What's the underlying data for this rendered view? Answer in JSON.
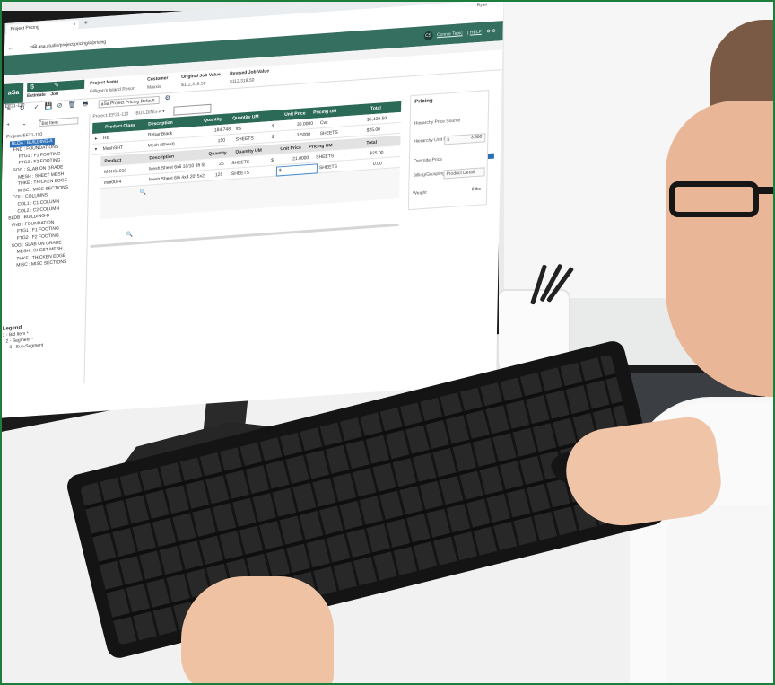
{
  "browser": {
    "tab_title": "Project Pricing",
    "tab_close": "×",
    "new_tab": "+",
    "window_controls": "–  □  ×",
    "user_chip": "Ryan",
    "nav_buttons": "←  →  C",
    "url": "trial.asa.studio/project/pricing/#/pricing"
  },
  "app_header": {
    "avatar_initials": "CS",
    "company_link": "Connie Tepic",
    "separator": "|",
    "help": "HELP",
    "icons": "⚙  ⚙"
  },
  "job_bar": {
    "logo": "aSa",
    "icons": "$  ✎  ▤  ▮",
    "side_labels": [
      "Estimate",
      "Job"
    ],
    "job_number": "EF21-110",
    "columns": [
      {
        "header": "Project Name",
        "value": "Gilligan's Island Resort"
      },
      {
        "header": "Customer",
        "value": "Maxxis"
      },
      {
        "header": "Original Job Value",
        "value": "$112,318.50"
      },
      {
        "header": "Revised Job Value",
        "value": "$112,318.50"
      }
    ]
  },
  "toolbar": {
    "icons": [
      "≡",
      "↻",
      "✓",
      "💾",
      "⊘",
      "🗑",
      "🖶"
    ],
    "pricing_select": "aSa Project Pricing Default",
    "gear": "⚙"
  },
  "breadcrumb": {
    "project": "Project: EF21-110",
    "building": "BUILDING-A ▾"
  },
  "sidebar": {
    "tools": "+  ⌄  ^",
    "filter": "Bid Item",
    "tree": [
      "Project: EF21-110",
      "BLDA : BUILDING-A",
      "FND : FOUNDATIONS",
      "FTG1 : F1 FOOTING",
      "FTG2 : F2 FOOTING",
      "SOG : SLAB ON GRADE",
      "MESH : SHEET MESH",
      "THKE : THICKEN EDGE",
      "MISC : MISC SECTIONS",
      "COL : COLUMNS",
      "COL1 : C1 COLUMN",
      "COL2 : C2 COLUMN",
      "BLDB : BUILDING-B",
      "FND : FOUNDATION",
      "FTG1 : F1 FOOTING",
      "FTG2 : F2 FOOTING",
      "SOG : SLAB ON GRADE",
      "MESH : SHEET MESH",
      "THKE : THICKEN EDGE",
      "MISC : MISC SECTIONS"
    ],
    "legend_title": "Legend",
    "legend_items": [
      "1 - Bid Item *",
      "2 - Segment *",
      "3 - Sub-Segment"
    ]
  },
  "grid": {
    "headers": [
      "Product Class",
      "Description",
      "Quantity",
      "Quantity UM",
      "Unit Price",
      "Pricing UM",
      "Total"
    ],
    "rows": [
      {
        "expand": "▸",
        "class": "RB",
        "description": "Rebar Black",
        "quantity": "184,748",
        "qty_um": "lbs",
        "unit_price": "$",
        "price": "30.0000",
        "pricing_um": "Cwt",
        "total": "$5,429.50"
      },
      {
        "expand": "▾",
        "class": "MeshSHT",
        "description": "Mesh (Sheet)",
        "quantity": "150",
        "qty_um": "SHEETS",
        "unit_price": "$",
        "price": "3.5000",
        "pricing_um": "SHEETS",
        "total": "$25.00"
      }
    ],
    "sub_headers": [
      "Product",
      "Description",
      "Quantity",
      "Quantity UM",
      "Unit Price",
      "Pricing UM",
      "Total"
    ],
    "sub_rows": [
      {
        "product": "MSH61010",
        "description": "Mesh Sheet 6x6 10/10 8ft 5f",
        "quantity": "25",
        "qty_um": "SHEETS",
        "unit_price": "$",
        "price": "21.0000",
        "pricing_um": "SHEETS",
        "total": "$25.00"
      },
      {
        "product": "mm0044",
        "description": "Mesh Sheet 6/6 4x4 20' 5x2",
        "quantity": "125",
        "qty_um": "SHEETS",
        "unit_price": "$",
        "price": "",
        "pricing_um": "SHEETS",
        "total": "0.00"
      }
    ],
    "search_icon": "🔍"
  },
  "pricing_panel": {
    "title": "Pricing",
    "rows": [
      {
        "label": "Hierarchy Price Source",
        "value": ""
      },
      {
        "label": "Hierarchy Unit Price",
        "value": "$",
        "right": "3.500"
      },
      {
        "label": "Override Price",
        "value": ""
      },
      {
        "label": "Billing/Grouping Method",
        "value": "Product Detail"
      },
      {
        "label": "Weight",
        "value": "",
        "right": "0 lbs"
      }
    ]
  }
}
